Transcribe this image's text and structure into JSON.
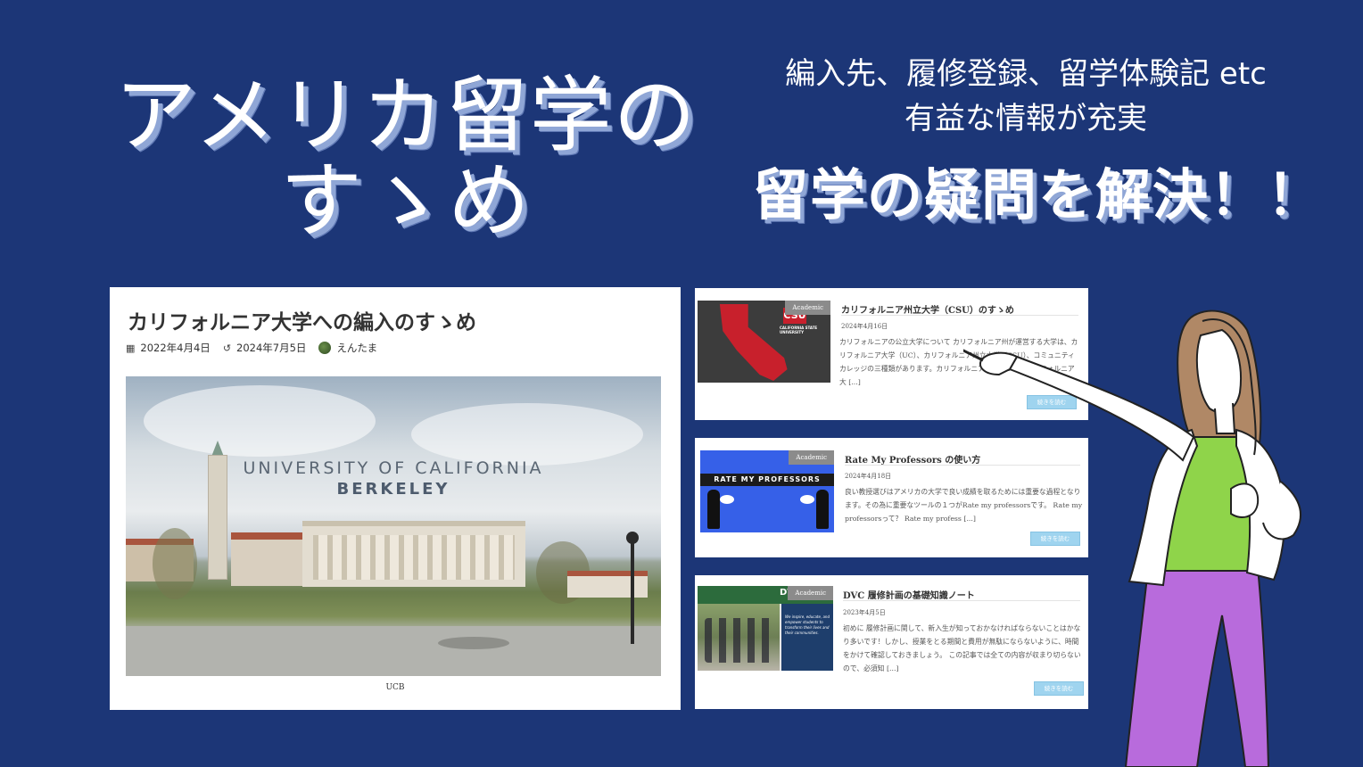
{
  "hero": {
    "title_line1": "アメリカ留学の",
    "title_line2": "すゝめ",
    "subtitle_line1": "編入先、履修登録、留学体験記 etc",
    "subtitle_line2": "有益な情報が充実",
    "headline": "留学の疑問を解決！！"
  },
  "main_article": {
    "title": "カリフォルニア大学への編入のすゝめ",
    "published": "2022年4月4日",
    "updated": "2024年7月5日",
    "author": "えんたま",
    "image_line1": "UNIVERSITY OF CALIFORNIA",
    "image_line2": "BERKELEY",
    "caption": "UCB",
    "icons": {
      "calendar": "calendar-icon",
      "updated": "history-icon",
      "author": "avatar"
    }
  },
  "articles": [
    {
      "badge": "Academic",
      "title": "カリフォルニア州立大学（CSU）のすゝめ",
      "date": "2024年4月16日",
      "excerpt": "カリフォルニアの公立大学について カリフォルニア州が運営する大学は、カリフォルニア大学（UC）、カリフォルニア州立大学（CSU）、コミュニティカレッジの三種類があります。カリフォルニア大学（UC） カリフォルニア大 [...]",
      "button": "続きを読む",
      "thumb_logo": "CSU",
      "thumb_text": "CALIFORNIA STATE UNIVERSITY"
    },
    {
      "badge": "Academic",
      "title": "Rate My Professors の使い方",
      "date": "2024年4月18日",
      "excerpt": "良い教授選びはアメリカの大学で良い成績を取るためには重要な過程となります。その為に重要なツールの１つがRate my professorsです。 Rate my professorsって？ Rate my profess [...]",
      "button": "続きを読む",
      "thumb_text": "RATE MY PROFESSORS"
    },
    {
      "badge": "Academic",
      "title": "DVC 履修計画の基礎知識ノート",
      "date": "2023年4月5日",
      "excerpt": "初めに 履修計画に関して、新入生が知っておかなければならないことはかなり多いです！しかし、授業をとる期間と費用が無駄にならないように、時間をかけて確認しておきましょう。 この記事では全ての内容が収まり切らないので、必須知 [...]",
      "button": "続きを読む",
      "thumb_logo": "DVC",
      "thumb_text": "We inspire, educate, and empower students to transform their lives and their communities."
    }
  ],
  "colors": {
    "background": "#1c3677",
    "badge": "#8b8b8b",
    "button": "#9fd4ef",
    "presenter_shirt": "#8fd44a",
    "presenter_pants": "#b86bdc"
  }
}
